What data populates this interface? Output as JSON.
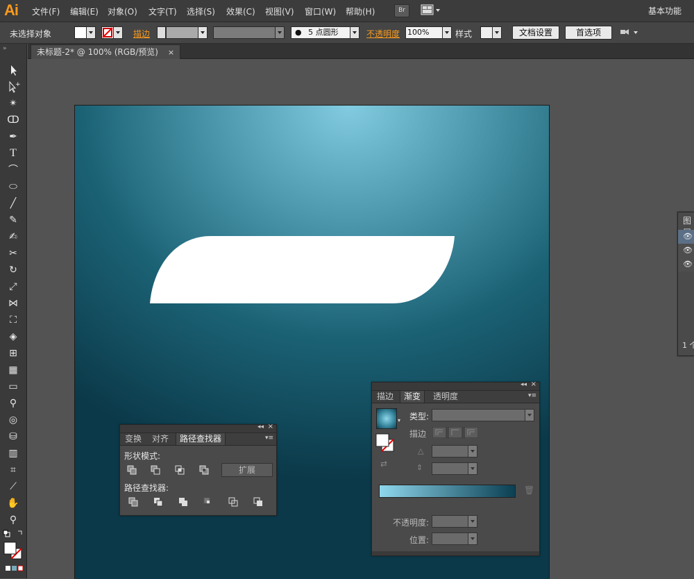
{
  "app": {
    "logo": "Ai"
  },
  "menu": {
    "items": [
      "文件(F)",
      "编辑(E)",
      "对象(O)",
      "文字(T)",
      "选择(S)",
      "效果(C)",
      "视图(V)",
      "窗口(W)",
      "帮助(H)"
    ],
    "bridge_label": "Br",
    "workspace": "基本功能"
  },
  "control": {
    "selection_status": "未选择对象",
    "stroke_label": "描边",
    "brush_label": "5 点圆形",
    "opacity_label": "不透明度",
    "opacity_value": "100%",
    "style_label": "样式",
    "doc_setup": "文档设置",
    "preferences": "首选项"
  },
  "document": {
    "tab_title": "未标题-2* @ 100% (RGB/预览)",
    "close": "×"
  },
  "colors": {
    "accent_orange": "#f79a1e",
    "artboard_light": "#82cbe0",
    "artboard_dark": "#0b3949",
    "gradient_start": "#8fd6ec",
    "gradient_end": "#0b3f52"
  },
  "pathfinder_panel": {
    "tabs": [
      "变换",
      "对齐",
      "路径查找器"
    ],
    "shape_modes_label": "形状模式:",
    "expand_button": "扩展",
    "pathfinders_label": "路径查找器:"
  },
  "gradient_panel": {
    "tabs": [
      "描边",
      "渐变",
      "透明度"
    ],
    "type_label": "类型:",
    "stroke_label": "描边",
    "opacity_label": "不透明度:",
    "location_label": "位置:"
  },
  "layers_panel": {
    "title": "图层",
    "count_label": "1 个"
  }
}
